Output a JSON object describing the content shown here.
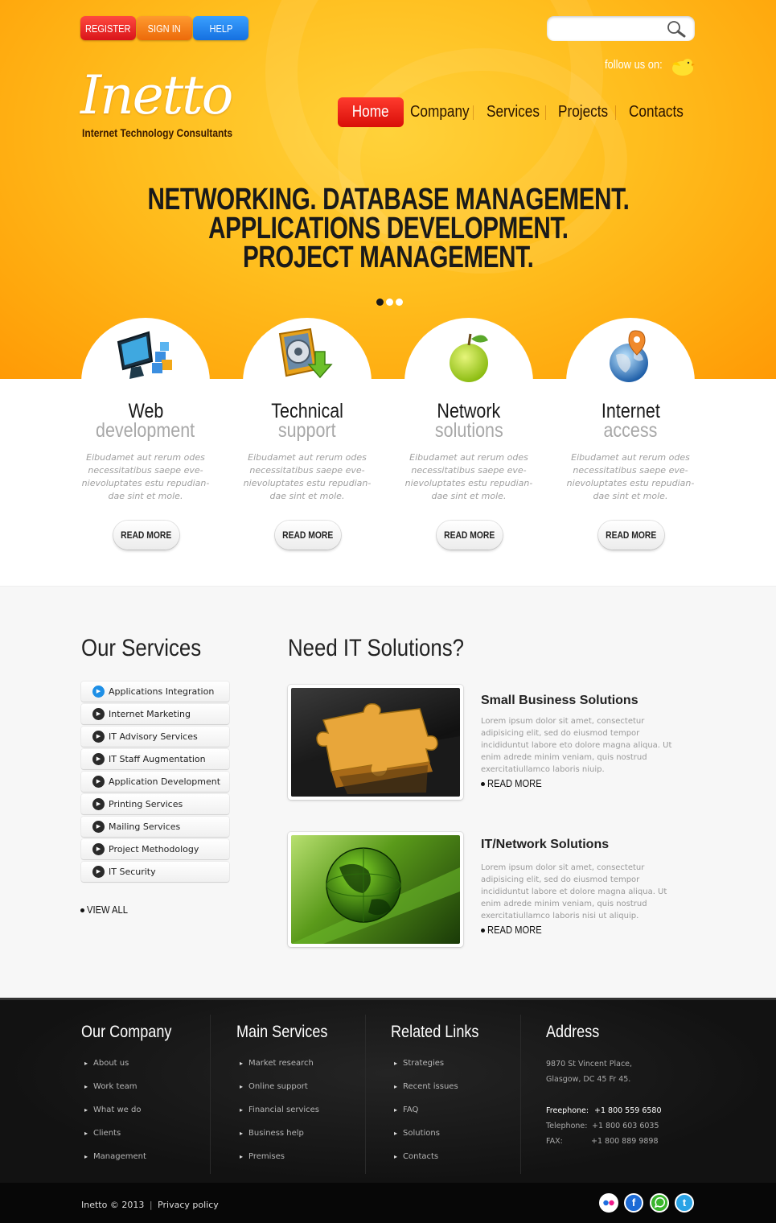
{
  "topbar": {
    "register_label": "REGISTER",
    "signin_label": "SIGN IN",
    "help_label": "HELP",
    "search_placeholder": "",
    "follow_label": "follow us on:",
    "colors": {
      "register": "#e8262c",
      "signin": "#f47a14",
      "help": "#1c86f0"
    }
  },
  "logo": {
    "name": "Inetto",
    "tagline": "Internet Technology Consultants"
  },
  "nav": {
    "items": [
      "Home",
      "Company",
      "Services",
      "Projects",
      "Contacts"
    ],
    "active": "Home"
  },
  "hero": {
    "lines": [
      "NETWORKING. DATABASE MANAGEMENT.",
      "APPLICATIONS DEVELOPMENT.",
      "PROJECT MANAGEMENT."
    ],
    "slides": 3,
    "active_slide": 1
  },
  "features": [
    {
      "title": "Web",
      "subtitle": "development",
      "icon": "monitor-cubes-icon",
      "text": "Eibudamet aut rerum odes necessitatibus saepe eve-nievoluptates estu repudian-dae sint et mole.",
      "button": "READ MORE"
    },
    {
      "title": "Technical",
      "subtitle": "support",
      "icon": "disk-arrow-icon",
      "text": "Eibudamet aut rerum odes necessitatibus saepe eve-nievoluptates estu repudian-dae sint et mole.",
      "button": "READ MORE"
    },
    {
      "title": "Network",
      "subtitle": "solutions",
      "icon": "apple-icon",
      "text": "Eibudamet aut rerum odes necessitatibus saepe eve-nievoluptates estu repudian-dae sint et mole.",
      "button": "READ MORE"
    },
    {
      "title": "Internet",
      "subtitle": "access",
      "icon": "globe-pin-icon",
      "text": "Eibudamet aut rerum odes necessitatibus saepe eve-nievoluptates estu repudian-dae sint et mole.",
      "button": "READ MORE"
    }
  ],
  "services": {
    "heading": "Our Services",
    "items": [
      "Applications Integration",
      "Internet Marketing",
      "IT Advisory Services",
      "IT Staff Augmentation",
      "Application Development",
      "Printing Services",
      "Mailing Services",
      "Project Methodology",
      "IT Security"
    ],
    "view_all": "VIEW ALL"
  },
  "solutions": {
    "heading": "Need IT Solutions?",
    "items": [
      {
        "title": "Small Business Solutions",
        "text": "Lorem ipsum dolor sit amet, consectetur adipisicing elit, sed do eiusmod tempor incididuntut labore eto dolore magna aliqua. Ut enim adrede minim veniam, quis nostrud exercitatiullamco laboris niuip.",
        "link": "READ MORE",
        "image": "puzzle-image"
      },
      {
        "title": "IT/Network Solutions",
        "text": "Lorem ipsum dolor sit amet, consectetur adipisicing elit, sed do eiusmod tempor incididuntut labore et dolore magna aliqua. Ut enim adrede minim veniam, quis nostrud exercitatiullamco laboris nisi ut aliquip.",
        "link": "READ MORE",
        "image": "green-globe-image"
      }
    ]
  },
  "footer": {
    "columns": [
      {
        "heading": "Our Company",
        "links": [
          "About us",
          "Work team",
          "What we do",
          "Clients",
          "Management"
        ]
      },
      {
        "heading": "Main Services",
        "links": [
          "Market research",
          "Online support",
          "Financial services",
          "Business help",
          "Premises"
        ]
      },
      {
        "heading": "Related Links",
        "links": [
          "Strategies",
          "Recent issues",
          "FAQ",
          "Solutions",
          "Contacts"
        ]
      }
    ],
    "address": {
      "heading": "Address",
      "line1": "9870 St Vincent Place,",
      "line2": "Glasgow, DC 45 Fr 45.",
      "freephone_label": "Freephone:",
      "freephone": "+1 800 559 6580",
      "telephone_label": "Telephone:",
      "telephone": "+1 800 603 6035",
      "fax_label": "FAX:",
      "fax": "+1 800 889 9898"
    },
    "copyright": "Inetto © 2013",
    "privacy": "Privacy policy",
    "social": [
      {
        "name": "flickr-icon",
        "color": "#1e8fe6"
      },
      {
        "name": "facebook-icon",
        "color": "#1d6bd6"
      },
      {
        "name": "whatsapp-icon",
        "color": "#3ab52c"
      },
      {
        "name": "twitter-icon",
        "color": "#2aa3e6"
      }
    ]
  }
}
